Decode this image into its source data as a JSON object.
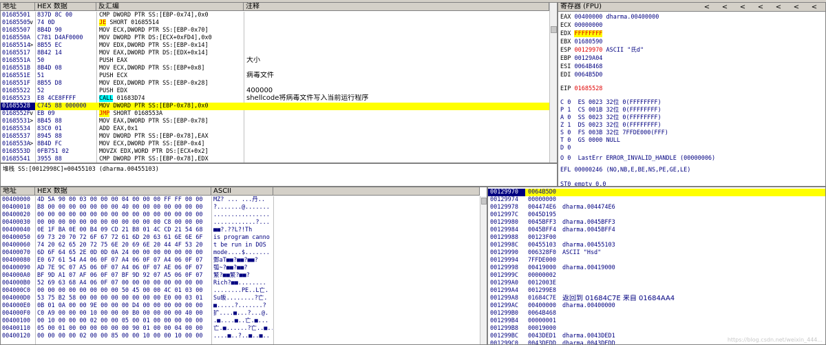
{
  "disasm": {
    "headers": {
      "address": "地址",
      "hex": "HEX 数据",
      "asm": "反汇编",
      "comment": "注释"
    },
    "rows": [
      {
        "addr": "01685501",
        "dot": "",
        "hex": "837D 8C 00",
        "asm": "CMP DWORD PTR SS:[EBP-0x74],0x0",
        "comment": "",
        "hl": ""
      },
      {
        "addr": "01685505",
        "dot": "v",
        "hex": "74 0D",
        "asm_tag": "JE",
        "asm": "SHORT 01685514",
        "comment": "",
        "hl": "je"
      },
      {
        "addr": "01685507",
        "dot": "",
        "hex": "8B4D 90",
        "asm": "MOV ECX,DWORD PTR SS:[EBP-0x70]",
        "comment": "",
        "hl": ""
      },
      {
        "addr": "0168550A",
        "dot": "",
        "hex": "C781 D4AF0000",
        "asm": "MOV DWORD PTR DS:[ECX+0xFD4],0x0",
        "comment": "",
        "hl": ""
      },
      {
        "addr": "01685514",
        "dot": ">",
        "hex": "8B55 EC",
        "asm": "MOV EDX,DWORD PTR SS:[EBP-0x14]",
        "comment": "",
        "hl": ""
      },
      {
        "addr": "01685517",
        "dot": "",
        "hex": "8B42 14",
        "asm": "MOV EAX,DWORD PTR DS:[EDX+0x14]",
        "comment": "",
        "hl": ""
      },
      {
        "addr": "0168551A",
        "dot": "",
        "hex": "50",
        "asm": "PUSH EAX",
        "comment": "大小",
        "hl": ""
      },
      {
        "addr": "0168551B",
        "dot": "",
        "hex": "8B4D 08",
        "asm": "MOV ECX,DWORD PTR SS:[EBP+0x8]",
        "comment": "",
        "hl": ""
      },
      {
        "addr": "0168551E",
        "dot": "",
        "hex": "51",
        "asm": "PUSH ECX",
        "comment": "病毒文件",
        "hl": ""
      },
      {
        "addr": "0168551F",
        "dot": "",
        "hex": "8B55 D8",
        "asm": "MOV EDX,DWORD PTR SS:[EBP-0x28]",
        "comment": "",
        "hl": ""
      },
      {
        "addr": "01685522",
        "dot": "",
        "hex": "52",
        "asm": "PUSH EDX",
        "comment": "400000",
        "hl": ""
      },
      {
        "addr": "01685523",
        "dot": "",
        "hex": "E8 4CE8FFFF",
        "asm_tag": "CALL",
        "asm": "01683D74",
        "comment": "shellcode将病毒文件写入当前运行程序",
        "hl": "call"
      },
      {
        "addr": "01685528",
        "dot": "",
        "hex": "C745 88 000000",
        "asm": "MOV DWORD PTR SS:[EBP-0x78],0x0",
        "comment": "",
        "hl": "sel"
      },
      {
        "addr": "0168552F",
        "dot": "v",
        "hex": "EB 09",
        "asm_tag": "JMP",
        "asm": "SHORT 0168553A",
        "comment": "",
        "hl": "jmp"
      },
      {
        "addr": "01685531",
        "dot": ">",
        "hex": "8B45 88",
        "asm": "MOV EAX,DWORD PTR SS:[EBP-0x78]",
        "comment": "",
        "hl": ""
      },
      {
        "addr": "01685534",
        "dot": "",
        "hex": "83C0 01",
        "asm": "ADD EAX,0x1",
        "comment": "",
        "hl": ""
      },
      {
        "addr": "01685537",
        "dot": "",
        "hex": "8945 88",
        "asm": "MOV DWORD PTR SS:[EBP-0x78],EAX",
        "comment": "",
        "hl": ""
      },
      {
        "addr": "0168553A",
        "dot": ">",
        "hex": "8B4D FC",
        "asm": "MOV ECX,DWORD PTR SS:[EBP-0x4]",
        "comment": "",
        "hl": ""
      },
      {
        "addr": "0168553D",
        "dot": "",
        "hex": "0FB751 02",
        "asm": "MOVZX EDX,WORD PTR DS:[ECX+0x2]",
        "comment": "",
        "hl": ""
      },
      {
        "addr": "01685541",
        "dot": "",
        "hex": "3955 88",
        "asm": "CMP DWORD PTR SS:[EBP-0x78],EDX",
        "comment": "",
        "hl": ""
      },
      {
        "addr": "01685544",
        "dot": "",
        "hex": "7D 27",
        "asm_tag": "JGE",
        "asm": "SHORT 0168556D",
        "comment": "",
        "hl": "jge"
      }
    ],
    "info_line": "堆栈 SS:[0012998C]=00455103 (dharma.00455103)"
  },
  "registers": {
    "title": "寄存器 (FPU)",
    "nav_buttons": [
      "<",
      "<",
      "<",
      "<",
      "<",
      "<",
      "<"
    ],
    "general": [
      {
        "name": "EAX",
        "value": "00400000",
        "note": "dharma.00400000",
        "hl": ""
      },
      {
        "name": "ECX",
        "value": "00000000",
        "note": "",
        "hl": ""
      },
      {
        "name": "EDX",
        "value": "FFFFFFFF",
        "note": "",
        "hl": "yellow"
      },
      {
        "name": "EBX",
        "value": "01680590",
        "note": "",
        "hl": ""
      },
      {
        "name": "ESP",
        "value": "00129970",
        "note": "ASCII \"氏d\"",
        "hl": "red"
      },
      {
        "name": "EBP",
        "value": "00129A04",
        "note": "",
        "hl": ""
      },
      {
        "name": "ESI",
        "value": "0064B468",
        "note": "",
        "hl": ""
      },
      {
        "name": "EDI",
        "value": "0064B5D0",
        "note": "",
        "hl": ""
      }
    ],
    "eip": {
      "name": "EIP",
      "value": "01685528"
    },
    "flags": [
      "C 0  ES 0023 32位 0(FFFFFFFF)",
      "P 1  CS 001B 32位 0(FFFFFFFF)",
      "A 0  SS 0023 32位 0(FFFFFFFF)",
      "Z 1  DS 0023 32位 0(FFFFFFFF)",
      "S 0  FS 003B 32位 7FFDE000(FFF)",
      "T 0  GS 0000 NULL",
      "D 0",
      "O 0  LastErr ERROR_INVALID_HANDLE (00000006)"
    ],
    "efl": "EFL 00000246 (NO,NB,E,BE,NS,PE,GE,LE)",
    "fpu": [
      "ST0 empty 0.0",
      "ST1 empty 0.0",
      "ST2 empty 0.0",
      "ST3 empty 0.0"
    ]
  },
  "dump": {
    "headers": {
      "address": "地址",
      "hex": "HEX 数据",
      "ascii": "ASCII"
    },
    "rows": [
      {
        "addr": "00400000",
        "hex": "4D 5A 90 00 03 00 00 00 04 00 00 00 FF FF 00 00",
        "ascii": "MZ? ... ...丹.."
      },
      {
        "addr": "00400010",
        "hex": "B8 00 00 00 00 00 00 00 40 00 00 00 00 00 00 00",
        "ascii": "?.......@......."
      },
      {
        "addr": "00400020",
        "hex": "00 00 00 00 00 00 00 00 00 00 00 00 00 00 00 00",
        "ascii": "................"
      },
      {
        "addr": "00400030",
        "hex": "00 00 00 00 00 00 00 00 00 00 00 00 C8 00 00 00",
        "ascii": "............?..."
      },
      {
        "addr": "00400040",
        "hex": "0E 1F BA 0E 00 B4 09 CD 21 B8 01 4C CD 21 54 68",
        "ascii": "■■?.??L?!Th"
      },
      {
        "addr": "00400050",
        "hex": "69 73 20 70 72 6F 67 72 61 6D 20 63 61 6E 6E 6F",
        "ascii": "is program canno"
      },
      {
        "addr": "00400060",
        "hex": "74 20 62 65 20 72 75 6E 20 69 6E 20 44 4F 53 20",
        "ascii": "t be run in DOS "
      },
      {
        "addr": "00400070",
        "hex": "6D 6F 64 65 2E 0D 0D 0A 24 00 00 00 00 00 00 00",
        "ascii": "mode....$......."
      },
      {
        "addr": "00400080",
        "hex": "E0 67 61 54 A4 06 0F 07 A4 06 0F 07 A4 06 0F 07",
        "ascii": "鄄aT■■?■■?■■?"
      },
      {
        "addr": "00400090",
        "hex": "AD 7E 9C 07 A5 06 0F 07 A4 06 0F 07 AE 06 0F 07",
        "ascii": "瓠~?■■?■■?"
      },
      {
        "addr": "004000A0",
        "hex": "BF 9D A1 07 AF 06 0F 07 BF 9D 92 07 A5 06 0F 07",
        "ascii": "繁?■■繁?■■?"
      },
      {
        "addr": "004000B0",
        "hex": "52 69 63 68 A4 06 0F 07 00 00 00 00 00 00 00 00",
        "ascii": "Rich?■■........"
      },
      {
        "addr": "004000C0",
        "hex": "00 00 00 00 00 00 00 00 50 45 00 00 4C 01 03 00",
        "ascii": "........PE..L亡."
      },
      {
        "addr": "004000D0",
        "hex": "53 75 B2 58 00 00 00 00 00 00 00 00 E0 00 03 01",
        "ascii": "Su皈........?亡."
      },
      {
        "addr": "004000E0",
        "hex": "0B 01 0A 00 00 9E 00 00 00 D4 00 00 00 00 00 00",
        "ascii": "■.....?.......?"
      },
      {
        "addr": "004000F0",
        "hex": "C0 A9 00 00 00 10 00 00 00 B0 00 00 00 00 40 00",
        "ascii": "扩....■...?...@."
      },
      {
        "addr": "00400100",
        "hex": "00 10 00 00 00 02 00 00 05 00 01 00 00 00 00 00",
        "ascii": ".■....■..亡.■..."
      },
      {
        "addr": "00400110",
        "os": "",
        "hex": "05 00 01 00 00 00 00 00 00 90 01 00 00 04 00 00",
        "ascii": "亡.■......?亡..■.."
      },
      {
        "addr": "00400120",
        "hex": "00 00 00 00 02 00 00 85 00 00 10 00 00 10 00 00",
        "ascii": "....■..?..■..■.."
      }
    ]
  },
  "stack": {
    "rows": [
      {
        "addr": "00129970",
        "value": "0064B5D0",
        "note": "",
        "hl": "top"
      },
      {
        "addr": "00129974",
        "value": "00000000",
        "note": "",
        "hl": ""
      },
      {
        "addr": "00129978",
        "value": "004474E6",
        "note": "dharma.004474E6",
        "hl": ""
      },
      {
        "addr": "0012997C",
        "value": "0045D195",
        "note": "",
        "hl": ""
      },
      {
        "addr": "00129980",
        "value": "0045BFF3",
        "note": "dharma.0045BFF3",
        "hl": ""
      },
      {
        "addr": "00129984",
        "value": "0045BFF4",
        "note": "dharma.0045BFF4",
        "hl": ""
      },
      {
        "addr": "00129988",
        "value": "00123F00",
        "note": "",
        "hl": ""
      },
      {
        "addr": "0012998C",
        "value": "00455103",
        "note": "dharma.00455103",
        "hl": ""
      },
      {
        "addr": "00129990",
        "value": "006328F0",
        "note": "ASCII \"Hsd\"",
        "hl": ""
      },
      {
        "addr": "00129994",
        "value": "7FFDE000",
        "note": "",
        "hl": ""
      },
      {
        "addr": "00129998",
        "value": "00419000",
        "note": "dharma.00419000",
        "hl": ""
      },
      {
        "addr": "0012999C",
        "value": "00000002",
        "note": "",
        "hl": ""
      },
      {
        "addr": "001299A0",
        "value": "0012003E",
        "note": "",
        "hl": ""
      },
      {
        "addr": "001299A4",
        "value": "001299E8",
        "note": "",
        "hl": ""
      },
      {
        "addr": "001299A8",
        "value": "01684C7E",
        "note": "返回到 01684C7E 来自 01684AA4",
        "hl": ""
      },
      {
        "addr": "001299AC",
        "value": "00400000",
        "note": "dharma.00400000",
        "hl": ""
      },
      {
        "addr": "001299B0",
        "value": "0064B468",
        "note": "",
        "hl": ""
      },
      {
        "addr": "001299B4",
        "value": "00000001",
        "note": "",
        "hl": ""
      },
      {
        "addr": "001299B8",
        "value": "00019000",
        "note": "",
        "hl": ""
      },
      {
        "addr": "001299BC",
        "value": "0043DED1",
        "note": "dharma.0043DED1",
        "hl": ""
      },
      {
        "addr": "001299C0",
        "value": "0043DEDD",
        "note": "dharma.0043DEDD",
        "hl": ""
      }
    ]
  },
  "watermark": "https://blog.csdn.net/weixin_444..."
}
